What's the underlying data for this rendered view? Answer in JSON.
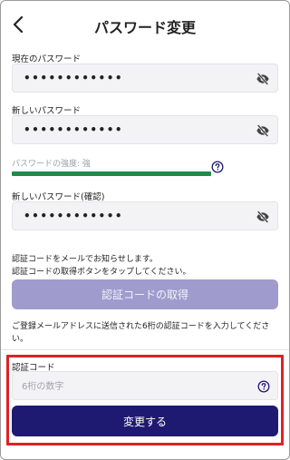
{
  "header": {
    "title": "パスワード変更",
    "back_icon": "chevron-left-icon"
  },
  "current_password": {
    "label": "現在のパスワード",
    "masked_value": "••••••••••••"
  },
  "new_password": {
    "label": "新しいパスワード",
    "masked_value": "••••••••••••"
  },
  "strength": {
    "label": "パスワードの強度: 強",
    "level": 1.0,
    "color": "#1f8a4c"
  },
  "confirm_password": {
    "label": "新しいパスワード(確認)",
    "masked_value": "••••••••••••"
  },
  "notice": {
    "line1": "認証コードをメールでお知らせします。",
    "line2": "認証コードの取得ボタンをタップしてください。"
  },
  "get_code_button": {
    "label": "認証コードの取得",
    "color": "#9f9ccd"
  },
  "description": {
    "text": "ご登録メールアドレスに送信された6桁の認証コードを入力してください。"
  },
  "verification_code": {
    "label": "認証コード",
    "placeholder": "6桁の数字",
    "value": ""
  },
  "submit_button": {
    "label": "変更する",
    "color": "#1e1a72"
  },
  "highlight": {
    "color": "#e01f26"
  }
}
